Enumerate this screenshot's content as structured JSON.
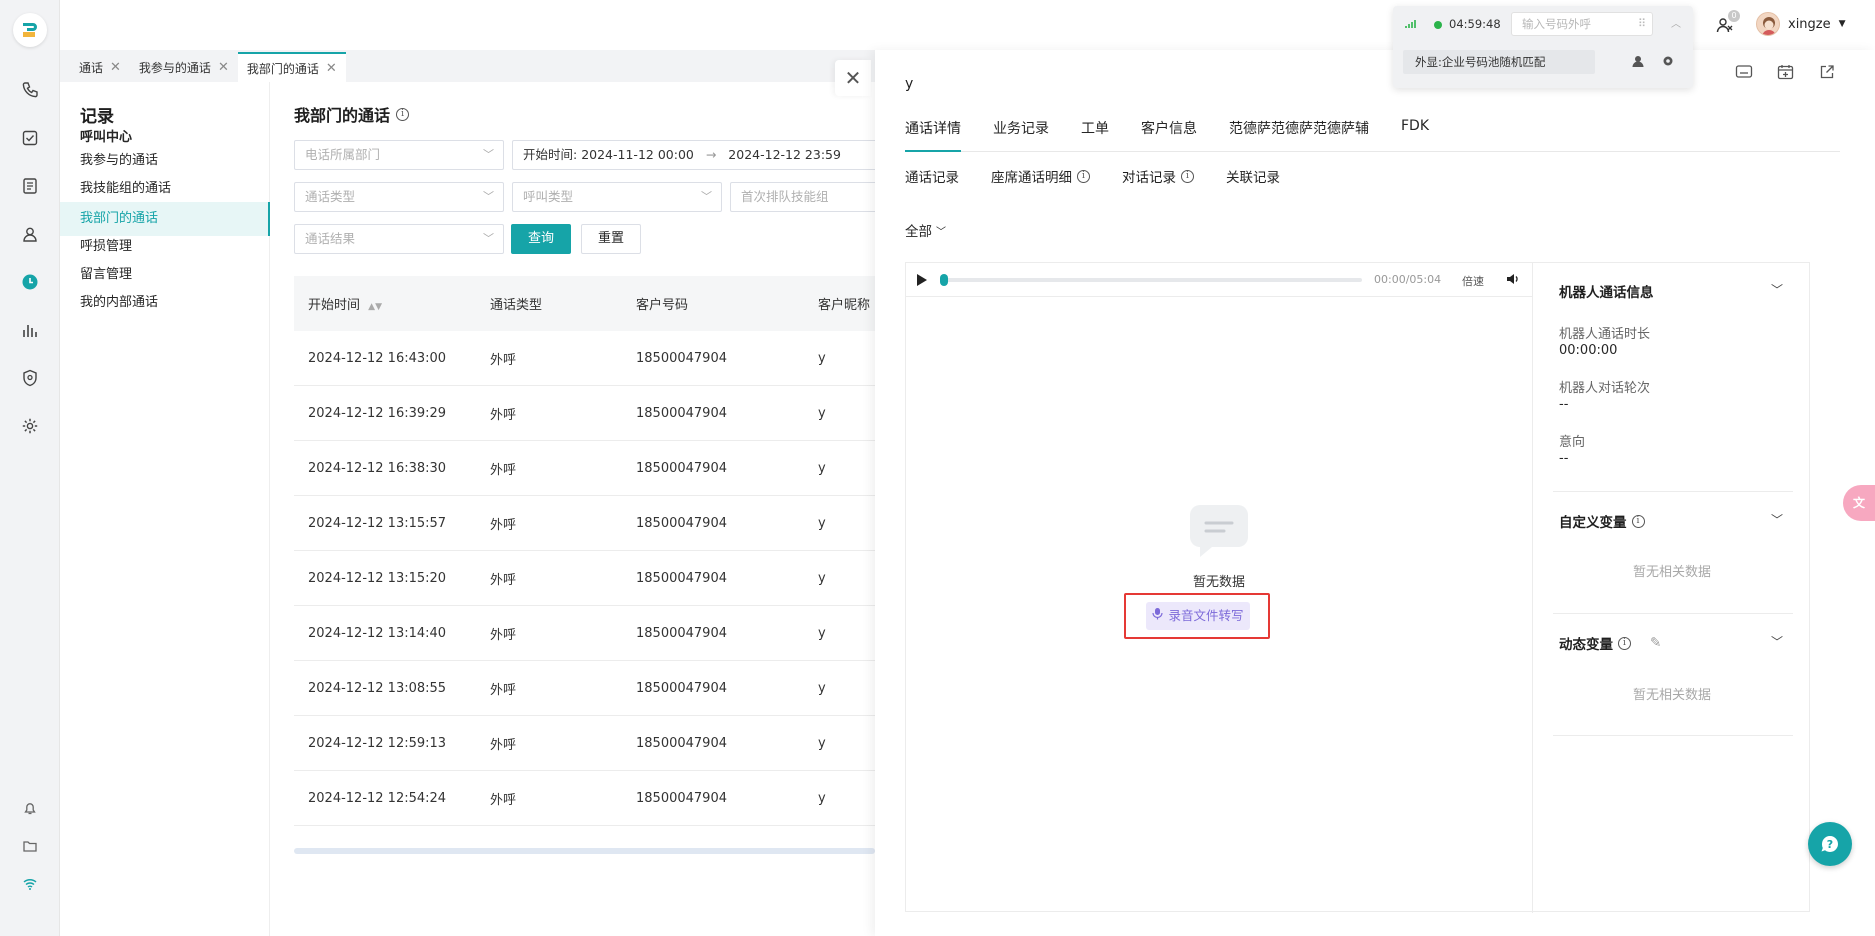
{
  "tabs": [
    {
      "label": "通话"
    },
    {
      "label": "我参与的通话"
    },
    {
      "label": "我部门的通话"
    }
  ],
  "sidebar": {
    "title": "记录",
    "group": "呼叫中心",
    "items": [
      {
        "label": "我参与的通话"
      },
      {
        "label": "我技能组的通话"
      },
      {
        "label": "我部门的通话"
      },
      {
        "label": "呼损管理"
      },
      {
        "label": "留言管理"
      },
      {
        "label": "我的内部通话"
      }
    ]
  },
  "main": {
    "title": "我部门的通话",
    "filters": {
      "dept_placeholder": "电话所属部门",
      "time_label": "开始时间:",
      "time_start": "2024-11-12 00:00",
      "time_arrow": "→",
      "time_end": "2024-12-12 23:59",
      "call_type_placeholder": "通话类型",
      "dial_type_placeholder": "呼叫类型",
      "skill_placeholder": "首次排队技能组",
      "result_placeholder": "通话结果",
      "query": "查询",
      "reset": "重置"
    },
    "table": {
      "headers": [
        "开始时间",
        "通话类型",
        "客户号码",
        "客户昵称"
      ],
      "rows": [
        {
          "time": "2024-12-12 16:43:00",
          "type": "外呼",
          "phone": "18500047904",
          "nick": "y"
        },
        {
          "time": "2024-12-12 16:39:29",
          "type": "外呼",
          "phone": "18500047904",
          "nick": "y"
        },
        {
          "time": "2024-12-12 16:38:30",
          "type": "外呼",
          "phone": "18500047904",
          "nick": "y"
        },
        {
          "time": "2024-12-12 13:15:57",
          "type": "外呼",
          "phone": "18500047904",
          "nick": "y"
        },
        {
          "time": "2024-12-12 13:15:20",
          "type": "外呼",
          "phone": "18500047904",
          "nick": "y"
        },
        {
          "time": "2024-12-12 13:14:40",
          "type": "外呼",
          "phone": "18500047904",
          "nick": "y"
        },
        {
          "time": "2024-12-12 13:08:55",
          "type": "外呼",
          "phone": "18500047904",
          "nick": "y"
        },
        {
          "time": "2024-12-12 12:59:13",
          "type": "外呼",
          "phone": "18500047904",
          "nick": "y"
        },
        {
          "time": "2024-12-12 12:54:24",
          "type": "外呼",
          "phone": "18500047904",
          "nick": "y"
        }
      ]
    }
  },
  "drawer": {
    "title": "y",
    "tabs": [
      "通话详情",
      "业务记录",
      "工单",
      "客户信息",
      "范德萨范德萨范德萨辅",
      "FDK"
    ],
    "subtabs": [
      "通话记录",
      "座席通话明细",
      "对话记录",
      "关联记录"
    ],
    "filter": "全部",
    "player": {
      "time": "00:00/05:04",
      "speed": "倍速"
    },
    "empty_text": "暂无数据",
    "transcribe_button": "录音文件转写",
    "robot": {
      "title": "机器人通话信息",
      "duration_label": "机器人通话时长",
      "duration_value": "00:00:00",
      "turns_label": "机器人对话轮次",
      "turns_value": "--",
      "intent_label": "意向",
      "intent_value": "--"
    },
    "custom_vars": {
      "title": "自定义变量",
      "empty": "暂无相关数据"
    },
    "dynamic_vars": {
      "title": "动态变量",
      "empty": "暂无相关数据"
    }
  },
  "callwidget": {
    "timer": "04:59:48",
    "input_placeholder": "输入号码外呼",
    "caller_id": "外显:企业号码池随机匹配"
  },
  "user": {
    "name": "xingze",
    "badge": "0"
  },
  "colors": {
    "accent": "#16a4a8",
    "highlight_border": "#e53935"
  }
}
